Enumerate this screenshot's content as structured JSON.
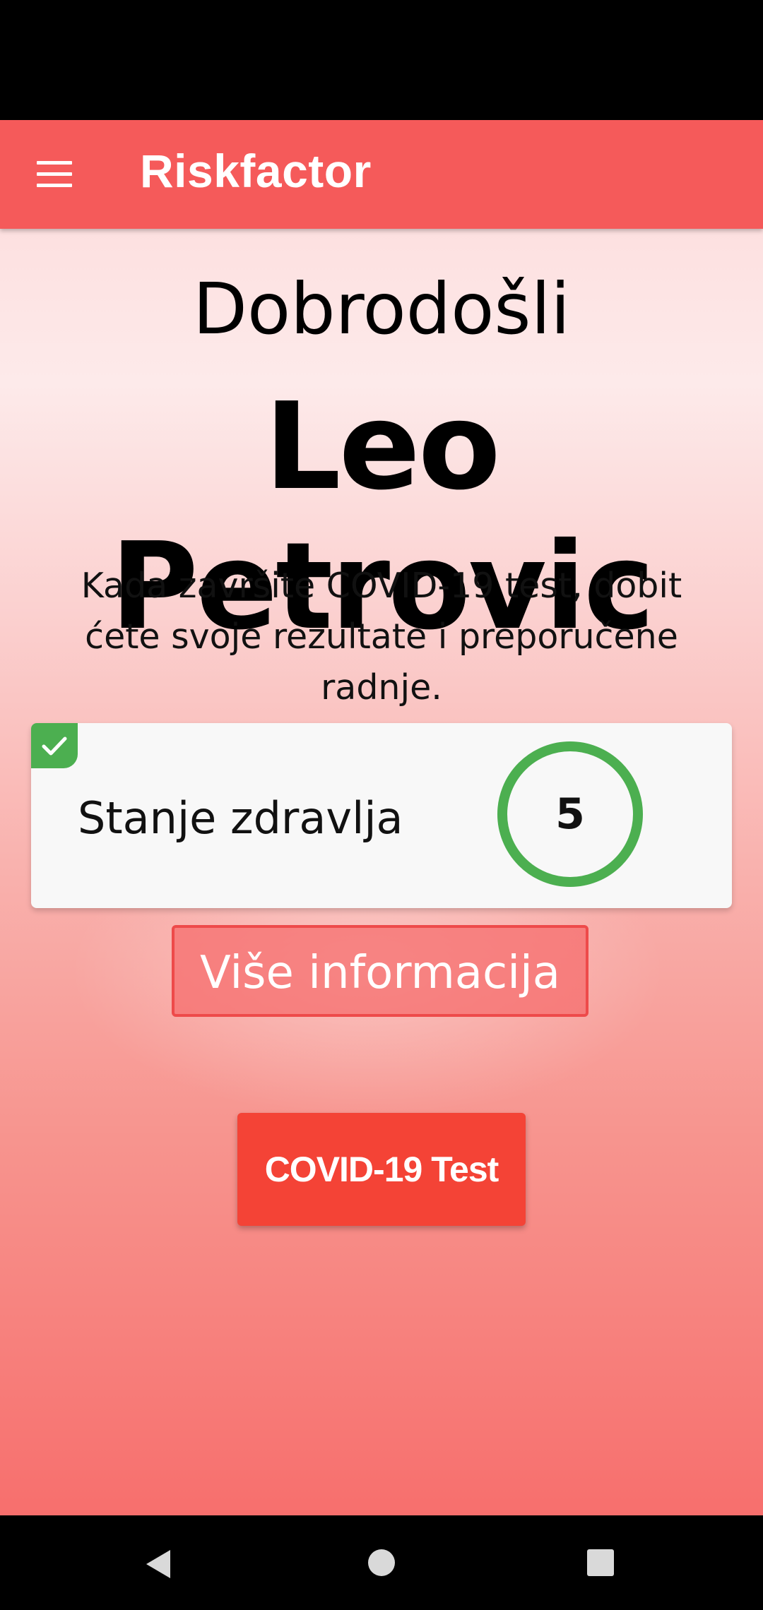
{
  "app_bar": {
    "title": "Riskfactor",
    "menu_icon": "hamburger-menu-icon"
  },
  "main": {
    "welcome": "Dobrodošli",
    "user_name": "Leo Petrovic",
    "intro_text": "Kada završite COVID-19 test, dobit ćete svoje rezultate i preporučene radnje.",
    "health_card": {
      "label": "Stanje zdravlja",
      "score": "5",
      "status_icon": "check-icon",
      "status_color": "#4caf50"
    },
    "more_info_label": "Više informacija",
    "covid_test_label": "COVID-19 Test"
  },
  "nav_bar": {
    "back_icon": "back-triangle-icon",
    "home_icon": "home-circle-icon",
    "recents_icon": "recents-square-icon"
  },
  "colors": {
    "app_bar": "#f55a5a",
    "primary_button": "#f44336",
    "accent_green": "#4caf50"
  }
}
